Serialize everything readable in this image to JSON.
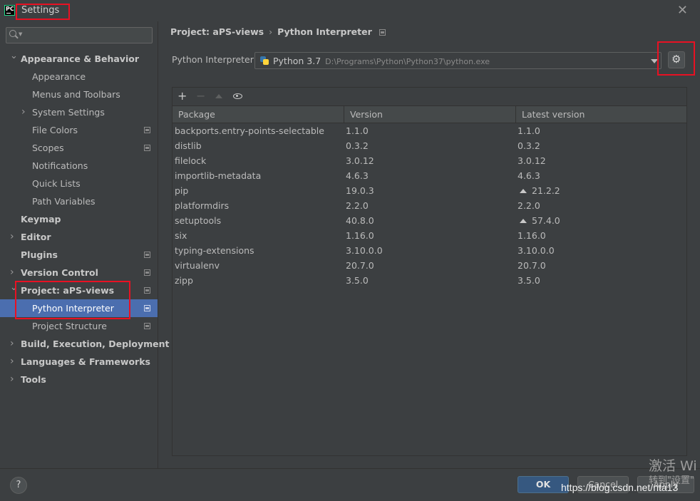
{
  "window": {
    "title": "Settings",
    "app_icon_text": "PC"
  },
  "sidebar": {
    "search_placeholder": "",
    "items": [
      {
        "label": "Appearance & Behavior",
        "level": 0,
        "expanded": true
      },
      {
        "label": "Appearance",
        "level": 1
      },
      {
        "label": "Menus and Toolbars",
        "level": 1
      },
      {
        "label": "System Settings",
        "level": 1,
        "collapsed": true
      },
      {
        "label": "File Colors",
        "level": 1,
        "project_scope": true
      },
      {
        "label": "Scopes",
        "level": 1,
        "project_scope": true
      },
      {
        "label": "Notifications",
        "level": 1
      },
      {
        "label": "Quick Lists",
        "level": 1
      },
      {
        "label": "Path Variables",
        "level": 1
      },
      {
        "label": "Keymap",
        "level": 0
      },
      {
        "label": "Editor",
        "level": 0,
        "collapsed": true
      },
      {
        "label": "Plugins",
        "level": 0,
        "project_scope": true
      },
      {
        "label": "Version Control",
        "level": 0,
        "collapsed": true,
        "project_scope": true
      },
      {
        "label": "Project: aPS-views",
        "level": 0,
        "expanded": true,
        "project_scope": true
      },
      {
        "label": "Python Interpreter",
        "level": 1,
        "selected": true,
        "project_scope": true
      },
      {
        "label": "Project Structure",
        "level": 1,
        "project_scope": true
      },
      {
        "label": "Build, Execution, Deployment",
        "level": 0,
        "collapsed": true
      },
      {
        "label": "Languages & Frameworks",
        "level": 0,
        "collapsed": true
      },
      {
        "label": "Tools",
        "level": 0,
        "collapsed": true
      }
    ]
  },
  "breadcrumb": {
    "project": "Project: aPS-views",
    "separator": "›",
    "page": "Python Interpreter"
  },
  "interpreter": {
    "label": "Python Interpreter:",
    "name": "Python 3.7",
    "path": "D:\\Programs\\Python\\Python37\\python.exe"
  },
  "toolbar": {
    "add": "+",
    "remove": "−"
  },
  "packages": {
    "columns": [
      "Package",
      "Version",
      "Latest version"
    ],
    "rows": [
      {
        "package": "backports.entry-points-selectable",
        "version": "1.1.0",
        "latest": "1.1.0",
        "upgrade": false
      },
      {
        "package": "distlib",
        "version": "0.3.2",
        "latest": "0.3.2",
        "upgrade": false
      },
      {
        "package": "filelock",
        "version": "3.0.12",
        "latest": "3.0.12",
        "upgrade": false
      },
      {
        "package": "importlib-metadata",
        "version": "4.6.3",
        "latest": "4.6.3",
        "upgrade": false
      },
      {
        "package": "pip",
        "version": "19.0.3",
        "latest": "21.2.2",
        "upgrade": true
      },
      {
        "package": "platformdirs",
        "version": "2.2.0",
        "latest": "2.2.0",
        "upgrade": false
      },
      {
        "package": "setuptools",
        "version": "40.8.0",
        "latest": "57.4.0",
        "upgrade": true
      },
      {
        "package": "six",
        "version": "1.16.0",
        "latest": "1.16.0",
        "upgrade": false
      },
      {
        "package": "typing-extensions",
        "version": "3.10.0.0",
        "latest": "3.10.0.0",
        "upgrade": false
      },
      {
        "package": "virtualenv",
        "version": "20.7.0",
        "latest": "20.7.0",
        "upgrade": false
      },
      {
        "package": "zipp",
        "version": "3.5.0",
        "latest": "3.5.0",
        "upgrade": false
      }
    ]
  },
  "footer": {
    "help": "?",
    "ok": "OK",
    "cancel": "Cancel",
    "apply": "Apply",
    "watermark": "https://blog.csdn.net/nta13",
    "activate_line1": "激活 Wi",
    "activate_line2": "转到\"设置\""
  },
  "colors": {
    "background": "#3c3f41",
    "selection": "#4b6eaf",
    "ok_button": "#365880",
    "annotation_red": "#e81123"
  }
}
